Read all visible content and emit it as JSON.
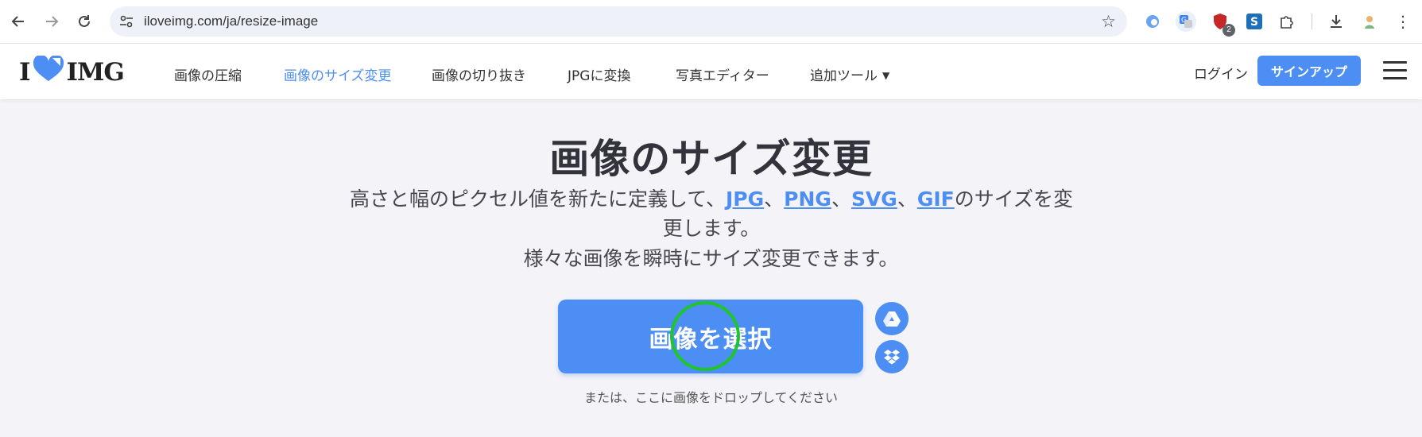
{
  "browser": {
    "url": "iloveimg.com/ja/resize-image",
    "extensions": [
      {
        "name": "edge-icon"
      },
      {
        "name": "translate-icon"
      },
      {
        "name": "shield-icon",
        "badge": "2"
      },
      {
        "name": "s-icon"
      },
      {
        "name": "puzzle-icon"
      }
    ]
  },
  "header": {
    "logo_left": "I",
    "logo_right": "IMG",
    "nav": [
      {
        "label": "画像の圧縮",
        "active": false
      },
      {
        "label": "画像のサイズ変更",
        "active": true
      },
      {
        "label": "画像の切り抜き",
        "active": false
      },
      {
        "label": "JPGに変換",
        "active": false
      },
      {
        "label": "写真エディター",
        "active": false
      },
      {
        "label": "追加ツール",
        "active": false
      }
    ],
    "login": "ログイン",
    "signup": "サインアップ"
  },
  "main": {
    "title": "画像のサイズ変更",
    "desc_prefix": "高さと幅のピクセル値を新たに定義して、",
    "formats": [
      "JPG",
      "PNG",
      "SVG",
      "GIF"
    ],
    "sep": "、",
    "desc_suffix": "のサイズを変更します。",
    "desc_line2": "様々な画像を瞬時にサイズ変更できます。",
    "select_button": "画像を選択",
    "drop_hint": "または、ここに画像をドロップしてください"
  },
  "colors": {
    "accent": "#4d8ef5",
    "cursor": "#1fc62a",
    "heart": "#4d8ef5"
  }
}
